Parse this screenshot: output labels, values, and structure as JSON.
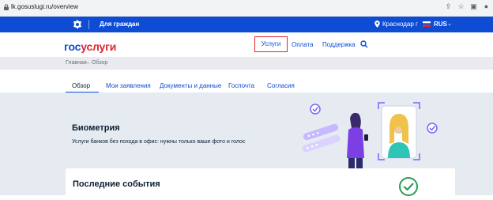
{
  "browser": {
    "url": "lk.gosuslugi.ru/overview"
  },
  "topbar": {
    "for_citizens": "Для граждан",
    "location": "Краснодар г",
    "language": "RUS"
  },
  "header": {
    "logo_gos": "гос",
    "logo_uslugi": "услуги",
    "nav": {
      "services": "Услуги",
      "payment": "Оплата",
      "support": "Поддержка"
    }
  },
  "breadcrumb": {
    "home": "Главная",
    "arrow": "→",
    "current": "Обзор"
  },
  "tabs": [
    {
      "label": "Обзор"
    },
    {
      "label": "Мои заявления"
    },
    {
      "label": "Документы и данные"
    },
    {
      "label": "Госпочта"
    },
    {
      "label": "Согласия"
    }
  ],
  "banner": {
    "title": "Биометрия",
    "subtitle": "Услуги банков без похода в офис: нужны только ваше фото и голос"
  },
  "events": {
    "title": "Последние события"
  },
  "colors": {
    "brand_blue": "#0d4cd3",
    "brand_red": "#e3262f",
    "check_green": "#2a9d55"
  }
}
